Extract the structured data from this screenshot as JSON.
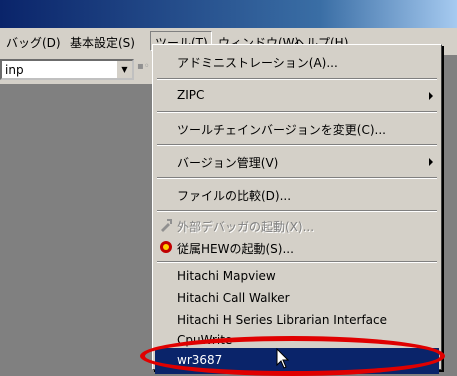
{
  "menubar": {
    "items": [
      "バッグ(D)",
      "基本設定(S)",
      "ツール(T)",
      "ウィンドウ(W)",
      "ヘルプ(H)"
    ]
  },
  "toolbar": {
    "combo_value": "inp"
  },
  "tools_menu": {
    "items": [
      {
        "label": "アドミニストレーション(A)...",
        "submenu": false,
        "disabled": false
      },
      {
        "label": "ZIPC",
        "submenu": true,
        "disabled": false
      },
      {
        "label": "ツールチェインバージョンを変更(C)...",
        "submenu": false,
        "disabled": false
      },
      {
        "label": "バージョン管理(V)",
        "submenu": true,
        "disabled": false
      },
      {
        "label": "ファイルの比較(D)...",
        "submenu": false,
        "disabled": false
      },
      {
        "label": "外部デバッガの起動(X)...",
        "submenu": false,
        "disabled": true
      },
      {
        "label": "従属HEWの起動(S)...",
        "submenu": false,
        "disabled": false
      },
      {
        "label": "Hitachi Mapview",
        "submenu": false,
        "disabled": false
      },
      {
        "label": "Hitachi Call Walker",
        "submenu": false,
        "disabled": false
      },
      {
        "label": "Hitachi H Series Librarian Interface",
        "submenu": false,
        "disabled": false
      },
      {
        "label": "CpuWrite",
        "submenu": false,
        "disabled": false
      },
      {
        "label": "wr3687",
        "submenu": false,
        "disabled": false,
        "selected": true
      }
    ]
  },
  "colors": {
    "menu_bg": "#d4d0c8",
    "selection": "#0a246a",
    "annotation_ring": "#e00000"
  }
}
